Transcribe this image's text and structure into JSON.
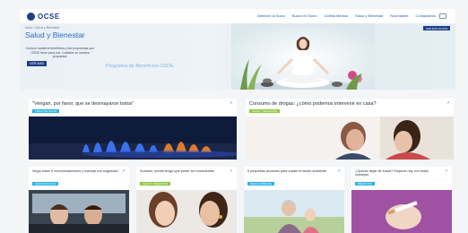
{
  "topbar": {
    "logo": "OCSE",
    "nav": [
      "Atención al Socio",
      "Busco mi Socio",
      "Cartilla Médica",
      "Salud y Bienestar",
      "Novedades",
      "Contactanos"
    ]
  },
  "hero": {
    "breadcrumb": "Inicio / Salud y Bienestar",
    "title": "Salud y Bienestar",
    "description": "Conocé nuestros beneficios y las propuestas que OSDE tiene para vos. Cuidarte es nuestra propuesta.",
    "button": "VER MÁS",
    "subtitle": "Programa de Beneficios OSDE",
    "right_button": "VER MÁS NOTAS"
  },
  "cards_large": [
    {
      "title": "\"Vengan, por favor, que se desmayaron todos\"",
      "tag": "TEMAS DE SALUD",
      "tag_color": "#2ab3e6"
    },
    {
      "title": "Consumo de drogas: ¿cómo podemos intervenir en casa?",
      "tag": "SALUD Y BIENESTAR",
      "tag_color": "#8cc63f"
    }
  ],
  "cards_small": [
    {
      "title": "Seguí estos 9 recomendaciones y manejá con seguridad",
      "tag": "SEGURIDAD VIAL",
      "tag_color": "#2ab3e6"
    },
    {
      "title": "Sumario: dónde tengo que poder ser conscientes",
      "tag": "SALUD Y BIENESTAR",
      "tag_color": "#8cc63f"
    },
    {
      "title": "5 pequeñas acciones para cuidar el medio ambiente",
      "tag": "MEDIO AMBIENTE",
      "tag_color": "#2ab3e6"
    },
    {
      "title": "¿Querés dejar de fumar? Empezá hoy con estos consejos",
      "tag": "BIENESTAR",
      "tag_color": "#2ab3e6"
    }
  ]
}
